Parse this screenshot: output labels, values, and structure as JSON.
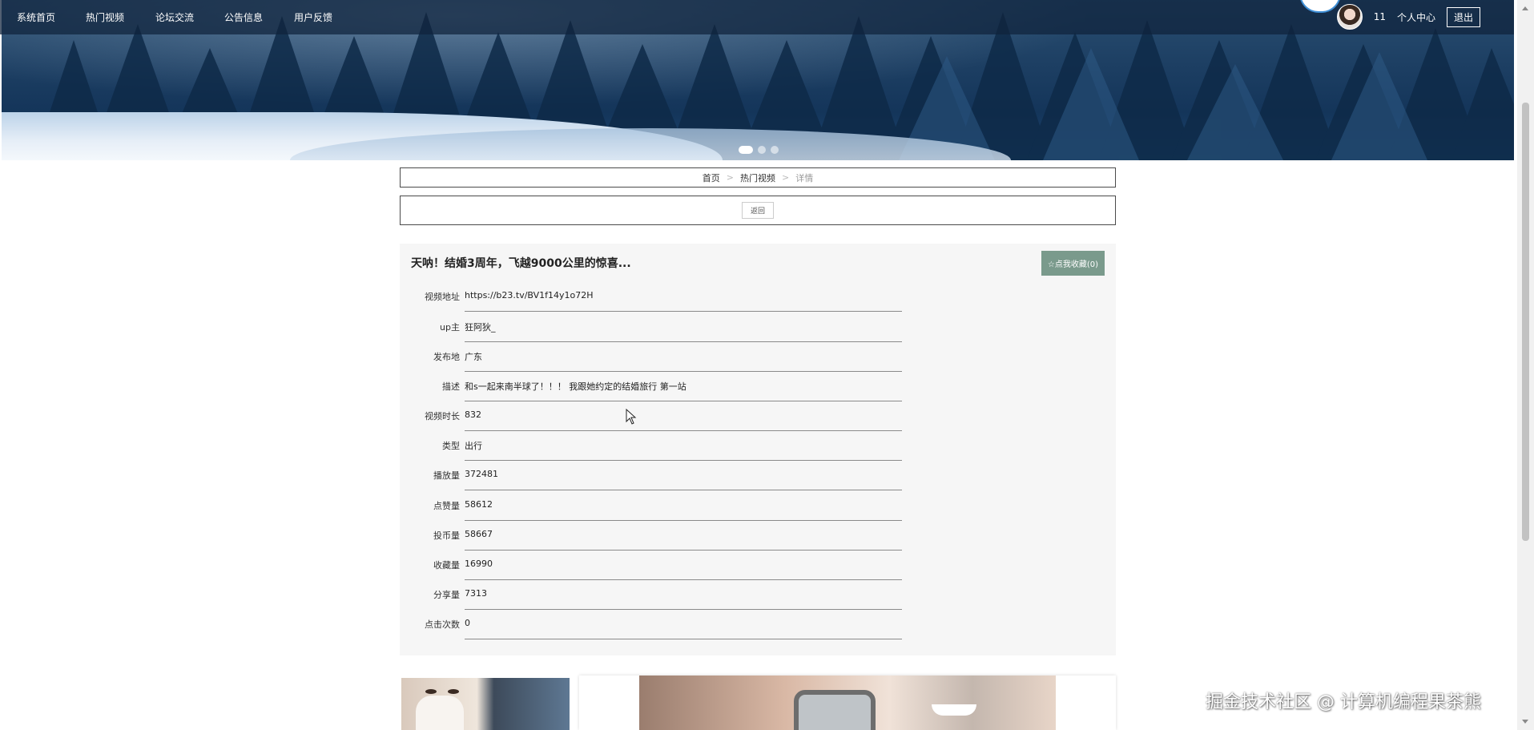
{
  "nav": {
    "items": [
      {
        "id": "home",
        "label": "系统首页"
      },
      {
        "id": "hot",
        "label": "热门视频"
      },
      {
        "id": "forum",
        "label": "论坛交流"
      },
      {
        "id": "notice",
        "label": "公告信息"
      },
      {
        "id": "feedback",
        "label": "用户反馈"
      }
    ],
    "user": {
      "name": "11",
      "center_label": "个人中心",
      "logout_label": "退出"
    }
  },
  "carousel": {
    "slides": 3,
    "active_index": 0
  },
  "breadcrumb": {
    "home": "首页",
    "section": "热门视频",
    "current": "详情",
    "separator": ">"
  },
  "back_label": "返回",
  "detail": {
    "title": "天呐！结婚3周年，飞越9000公里的惊喜...",
    "favorite_label": "☆点我收藏(0)",
    "fields": [
      {
        "label": "视频地址",
        "value": "https://b23.tv/BV1f14y1o72H"
      },
      {
        "label": "up主",
        "value": "狂阿狄_"
      },
      {
        "label": "发布地",
        "value": "广东"
      },
      {
        "label": "描述",
        "value": "和s一起来南半球了！！！ 我跟她约定的结婚旅行 第一站"
      },
      {
        "label": "视频时长",
        "value": "832"
      },
      {
        "label": "类型",
        "value": "出行"
      },
      {
        "label": "播放量",
        "value": "372481"
      },
      {
        "label": "点赞量",
        "value": "58612"
      },
      {
        "label": "投币量",
        "value": "58667"
      },
      {
        "label": "收藏量",
        "value": "16990"
      },
      {
        "label": "分享量",
        "value": "7313"
      },
      {
        "label": "点击次数",
        "value": "0"
      }
    ]
  },
  "watermark": "掘金技术社区 @ 计算机编程果茶熊",
  "colors": {
    "nav_bg": "#0f233c",
    "favorite_bg": "#7a9a8c",
    "panel_bg": "#f6f6f6"
  }
}
